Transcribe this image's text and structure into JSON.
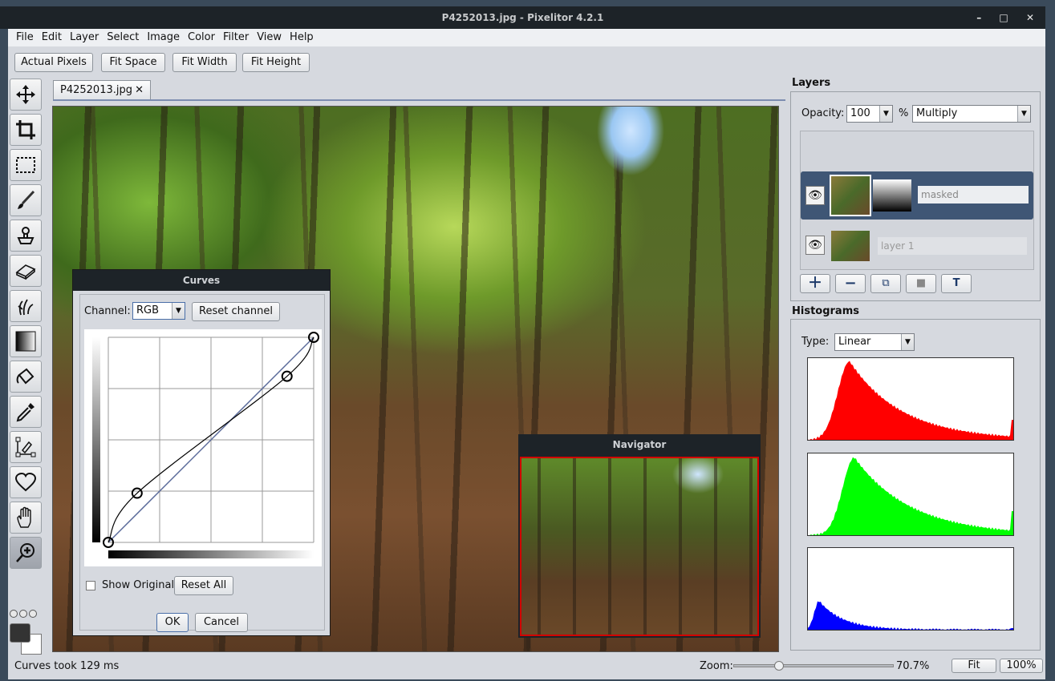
{
  "window": {
    "title": "P4252013.jpg - Pixelitor 4.2.1",
    "controls": [
      "–",
      "□",
      "✕"
    ]
  },
  "menu": [
    "File",
    "Edit",
    "Layer",
    "Select",
    "Image",
    "Color",
    "Filter",
    "View",
    "Help"
  ],
  "toolbar": {
    "actual_pixels": "Actual Pixels",
    "fit_space": "Fit Space",
    "fit_width": "Fit Width",
    "fit_height": "Fit Height"
  },
  "tab": {
    "title": "P4252013.jpg",
    "close": "✕"
  },
  "tools": [
    "move-tool-icon",
    "crop-tool-icon",
    "selection-tool-icon",
    "brush-tool-icon",
    "clone-tool-icon",
    "eraser-tool-icon",
    "smudge-tool-icon",
    "gradient-tool-icon",
    "paint-bucket-tool-icon",
    "color-picker-tool-icon",
    "pen-tool-icon",
    "shapes-tool-icon",
    "hand-tool-icon",
    "zoom-tool-icon"
  ],
  "curves": {
    "title": "Curves",
    "channel_label": "Channel:",
    "channel_value": "RGB",
    "reset_channel": "Reset channel",
    "show_original": "Show Original",
    "reset_all": "Reset All",
    "ok": "OK",
    "cancel": "Cancel",
    "points": [
      [
        0,
        0
      ],
      [
        0.14,
        0.24
      ],
      [
        0.87,
        0.81
      ],
      [
        1,
        1
      ]
    ]
  },
  "navigator": {
    "title": "Navigator"
  },
  "layers": {
    "title": "Layers",
    "opacity_label": "Opacity:",
    "opacity_value": "100",
    "percent": "%",
    "blend_mode": "Multiply",
    "items": [
      {
        "name": "masked",
        "selected": true
      },
      {
        "name": "layer 1",
        "selected": false
      }
    ]
  },
  "histograms": {
    "title": "Histograms",
    "type_label": "Type:",
    "type_value": "Linear",
    "colors": [
      "#ff0000",
      "#00ff00",
      "#0000ff"
    ]
  },
  "status": {
    "message": "Curves took 129 ms",
    "zoom_label": "Zoom:",
    "zoom_value": "70.7%",
    "zoom_fraction": 0.28,
    "fit": "Fit",
    "hundred": "100%"
  }
}
